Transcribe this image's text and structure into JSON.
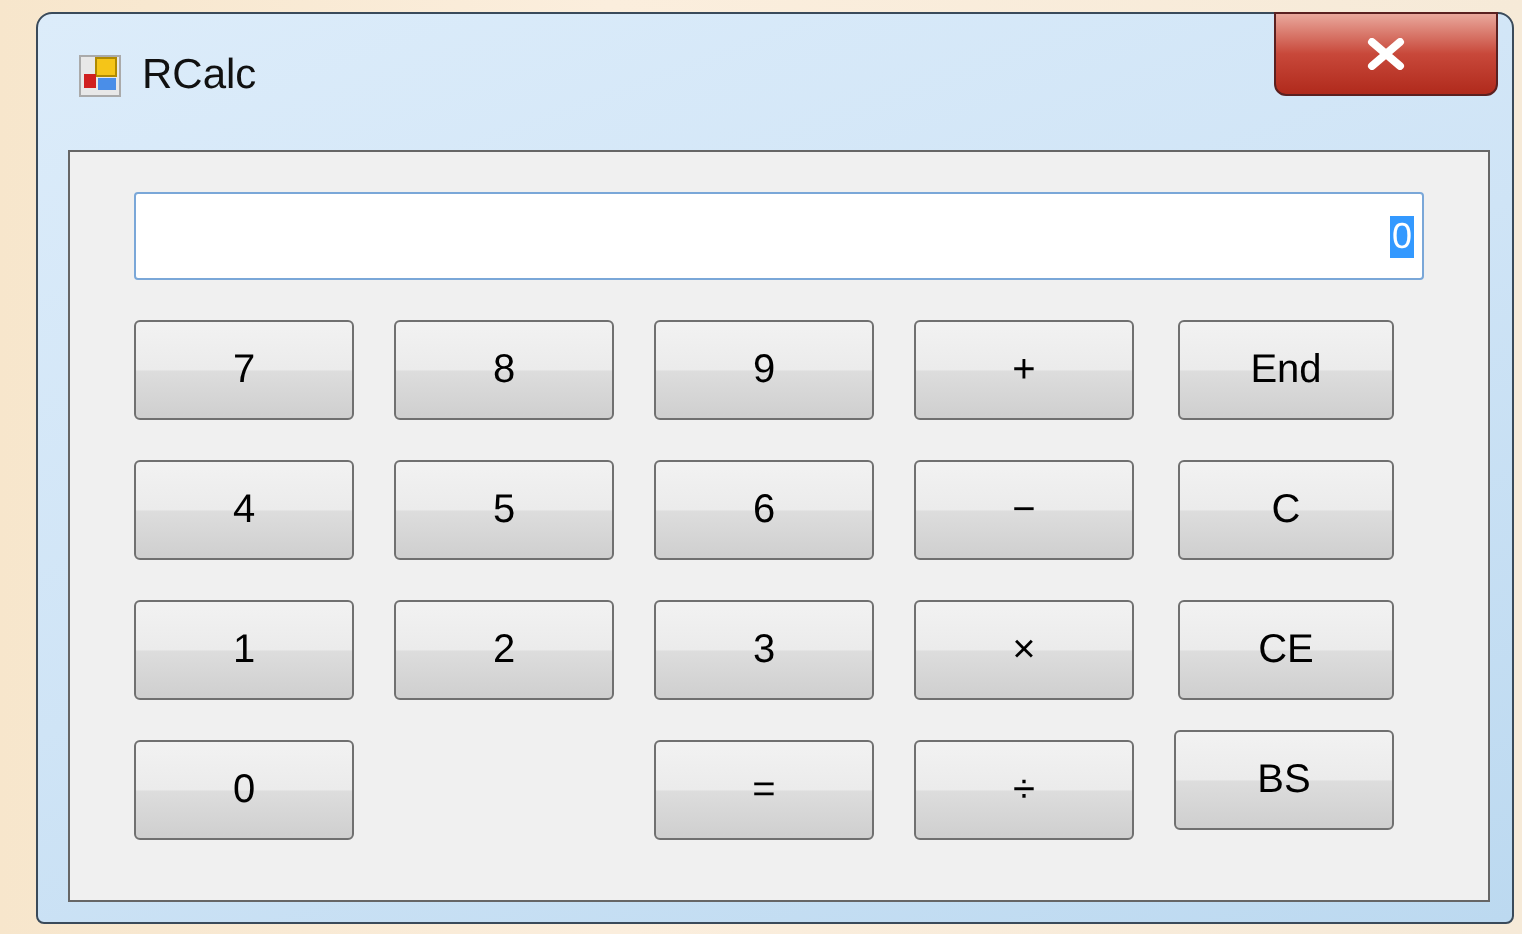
{
  "window": {
    "title": "RCalc"
  },
  "display": {
    "value": "0",
    "value_selected": true
  },
  "keys": [
    {
      "label": "7"
    },
    {
      "label": "8"
    },
    {
      "label": "9"
    },
    {
      "label": "+"
    },
    {
      "label": "End"
    },
    {
      "label": "4"
    },
    {
      "label": "5"
    },
    {
      "label": "6"
    },
    {
      "label": "−"
    },
    {
      "label": "C"
    },
    {
      "label": "1"
    },
    {
      "label": "2"
    },
    {
      "label": "3"
    },
    {
      "label": "×"
    },
    {
      "label": "CE"
    },
    {
      "label": "0"
    },
    {
      "label": "="
    },
    {
      "label": "÷"
    },
    {
      "label": "BS"
    }
  ]
}
